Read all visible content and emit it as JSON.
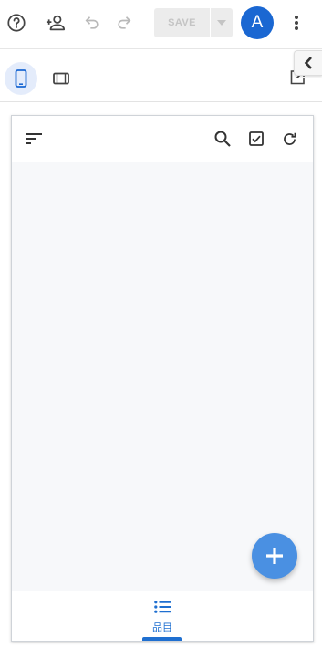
{
  "toolbar": {
    "help_icon": "help-circle-icon",
    "share_icon": "person-add-icon",
    "undo_icon": "undo-icon",
    "redo_icon": "redo-icon",
    "save_label": "SAVE",
    "save_dropdown_icon": "caret-down-icon",
    "avatar_letter": "A",
    "more_icon": "more-vert-icon"
  },
  "view_bar": {
    "phone_view_icon": "smartphone-icon",
    "tablet_view_icon": "tablet-icon",
    "open_external_icon": "open-in-new-icon",
    "collapse_icon": "chevron-left-icon"
  },
  "app_preview": {
    "header_icons": [
      "sort-icon",
      "search-icon",
      "checkbox-icon",
      "refresh-icon"
    ],
    "fab_icon": "add-icon",
    "bottom_nav": {
      "items": [
        {
          "label": "品目",
          "icon": "list-icon",
          "active": true
        }
      ]
    }
  },
  "colors": {
    "accent": "#1a67d2",
    "fab": "#4a90e2",
    "nav_active": "#1f6fd0",
    "save_disabled_bg": "#ececec",
    "save_disabled_text": "#c4c4c4"
  }
}
